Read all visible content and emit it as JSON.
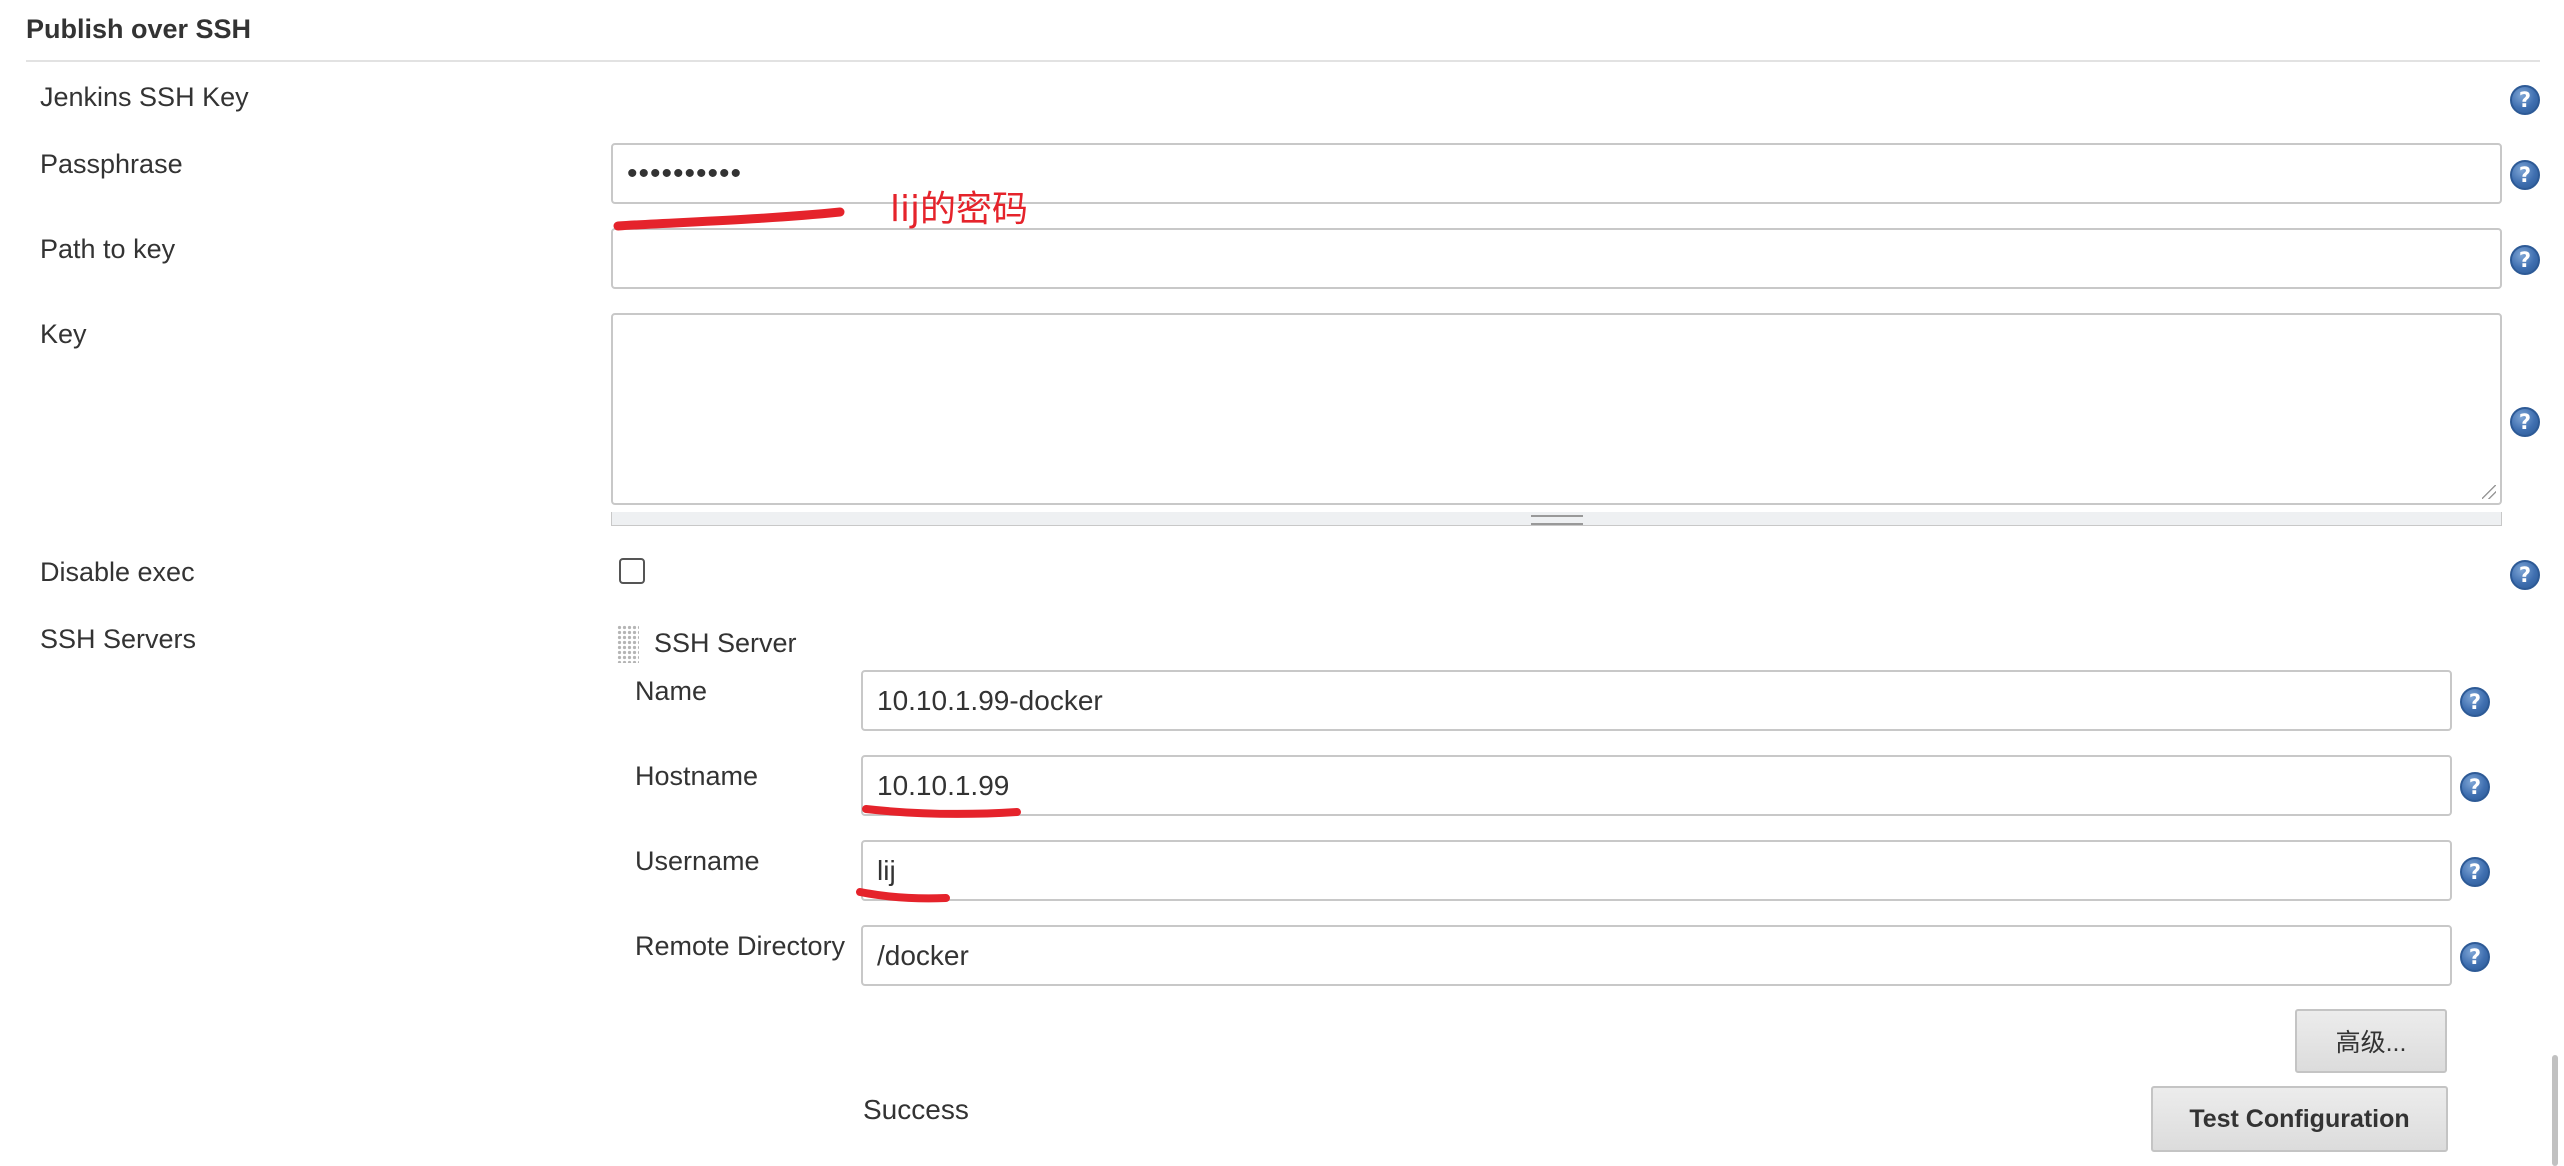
{
  "section": {
    "title": "Publish over SSH"
  },
  "fields": {
    "jenkins_ssh_key": {
      "label": "Jenkins SSH Key"
    },
    "passphrase": {
      "label": "Passphrase",
      "value": "••••••••••"
    },
    "path_to_key": {
      "label": "Path to key",
      "value": ""
    },
    "key": {
      "label": "Key",
      "value": ""
    },
    "disable_exec": {
      "label": "Disable exec",
      "checked": false
    },
    "ssh_servers": {
      "label": "SSH Servers"
    }
  },
  "ssh_server": {
    "header": "SSH Server",
    "name": {
      "label": "Name",
      "value": "10.10.1.99-docker"
    },
    "hostname": {
      "label": "Hostname",
      "value": "10.10.1.99"
    },
    "username": {
      "label": "Username",
      "value": "lij"
    },
    "remote_directory": {
      "label": "Remote Directory",
      "value": "/docker"
    },
    "advanced_button": "高级...",
    "status_text": "Success",
    "test_button": "Test Configuration"
  },
  "annotation": {
    "text": "lij的密码",
    "color": "#e5232b"
  },
  "help_icon": "?",
  "colors": {
    "help_icon": "#3f6fb0",
    "annotation": "#e5232b"
  }
}
